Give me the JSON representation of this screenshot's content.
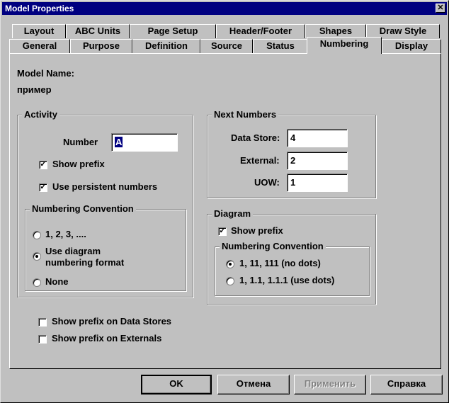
{
  "window": {
    "title": "Model Properties",
    "close_glyph": "✕"
  },
  "tabs_row1": [
    "Layout",
    "ABC Units",
    "Page Setup",
    "Header/Footer",
    "Shapes",
    "Draw Style"
  ],
  "tabs_row2": [
    "General",
    "Purpose",
    "Definition",
    "Source",
    "Status",
    "Numbering",
    "Display"
  ],
  "active_tab": "Numbering",
  "model": {
    "name_label": "Model Name:",
    "name_value": "пример"
  },
  "activity": {
    "title": "Activity",
    "number_label": "Number",
    "number_value": "A",
    "show_prefix": {
      "label": "Show prefix",
      "checked": true
    },
    "persistent": {
      "label": "Use persistent numbers",
      "checked": true
    },
    "convention": {
      "title": "Numbering Convention",
      "options": [
        {
          "label": "1, 2, 3, ....",
          "selected": false
        },
        {
          "label": "Use diagram",
          "label2": "numbering format",
          "selected": true
        },
        {
          "label": "None",
          "selected": false
        }
      ]
    }
  },
  "next_numbers": {
    "title": "Next Numbers",
    "data_store": {
      "label": "Data Store:",
      "value": "4"
    },
    "external": {
      "label": "External:",
      "value": "2"
    },
    "uow": {
      "label": "UOW:",
      "value": "1"
    }
  },
  "diagram": {
    "title": "Diagram",
    "show_prefix": {
      "label": "Show prefix",
      "checked": true
    },
    "convention": {
      "title": "Numbering Convention",
      "options": [
        {
          "label": "1, 11, 111 (no dots)",
          "selected": true
        },
        {
          "label": "1, 1.1, 1.1.1 (use dots)",
          "selected": false
        }
      ]
    }
  },
  "bottom": {
    "prefix_data_stores": {
      "label": "Show prefix on Data Stores",
      "checked": false
    },
    "prefix_externals": {
      "label": "Show prefix on Externals",
      "checked": false
    }
  },
  "buttons": {
    "ok": "OK",
    "cancel": "Отмена",
    "apply": "Применить",
    "help": "Справка"
  },
  "check_glyph": "✓"
}
